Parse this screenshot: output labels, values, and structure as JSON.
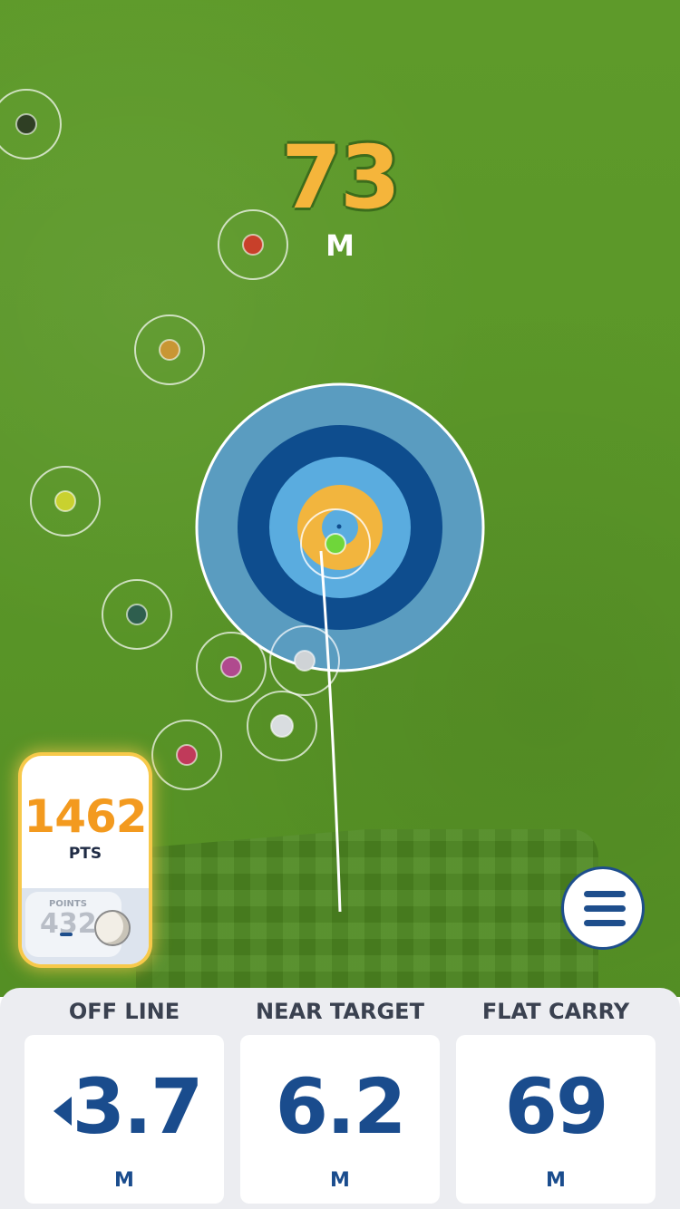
{
  "target": {
    "distance": "73",
    "distance_unit": "M"
  },
  "score": {
    "points": "1462",
    "points_label": "PTS",
    "previous_label": "POINTS",
    "previous_points": "432"
  },
  "shots": [
    {
      "color": "#2f3f24"
    },
    {
      "color": "#c8402a"
    },
    {
      "color": "#c89634"
    },
    {
      "color": "#c9d12f"
    },
    {
      "color": "#2e5e4e"
    },
    {
      "color": "#b04a8e"
    },
    {
      "color": "#cfd3d6"
    },
    {
      "color": "#d9dde0"
    },
    {
      "color": "#c03a5a"
    },
    {
      "color": "#6fd63a"
    }
  ],
  "target_rings": {
    "outer": "#5a9cc0",
    "dark": "#0e4d8e",
    "light": "#5aacdf",
    "center": "#f2b53e"
  },
  "menu": {
    "icon": "hamburger-icon"
  },
  "stats": [
    {
      "title": "OFF LINE",
      "value": "3.7",
      "unit": "M",
      "direction": "left"
    },
    {
      "title": "NEAR TARGET",
      "value": "6.2",
      "unit": "M"
    },
    {
      "title": "FLAT CARRY",
      "value": "69",
      "unit": "M"
    }
  ],
  "colors": {
    "accent_blue": "#1a4c8d",
    "score_orange": "#f39a1f",
    "distance_yellow": "#f5b53b"
  }
}
